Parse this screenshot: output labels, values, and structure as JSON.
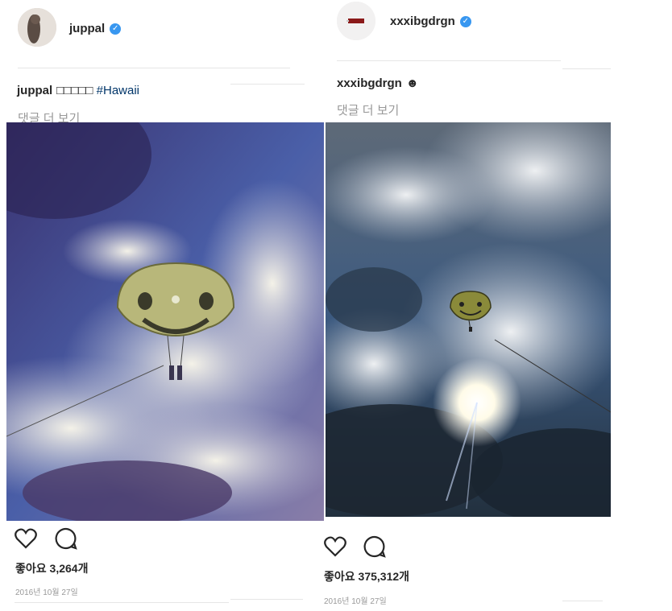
{
  "posts": [
    {
      "username": "juppal",
      "caption_user": "juppal",
      "caption_text": "□□□□□",
      "hashtag": "#Hawaii",
      "more_comments": "댓글 더 보기",
      "likes": "좋아요 3,264개",
      "date": "2016년 10월 27일",
      "icons": [
        "heart-icon",
        "comment-icon",
        "verified-badge-icon"
      ]
    },
    {
      "username": "xxxibgdrgn",
      "caption_user": "xxxibgdrgn",
      "caption_emoji": "☻",
      "more_comments": "댓글 더 보기",
      "likes": "좋아요 375,312개",
      "date": "2016년 10월 27일",
      "icons": [
        "heart-icon",
        "comment-icon",
        "verified-badge-icon"
      ]
    }
  ],
  "colors": {
    "verified_blue": "#3897f0",
    "hashtag": "#003569",
    "muted": "#999999",
    "text": "#262626"
  }
}
